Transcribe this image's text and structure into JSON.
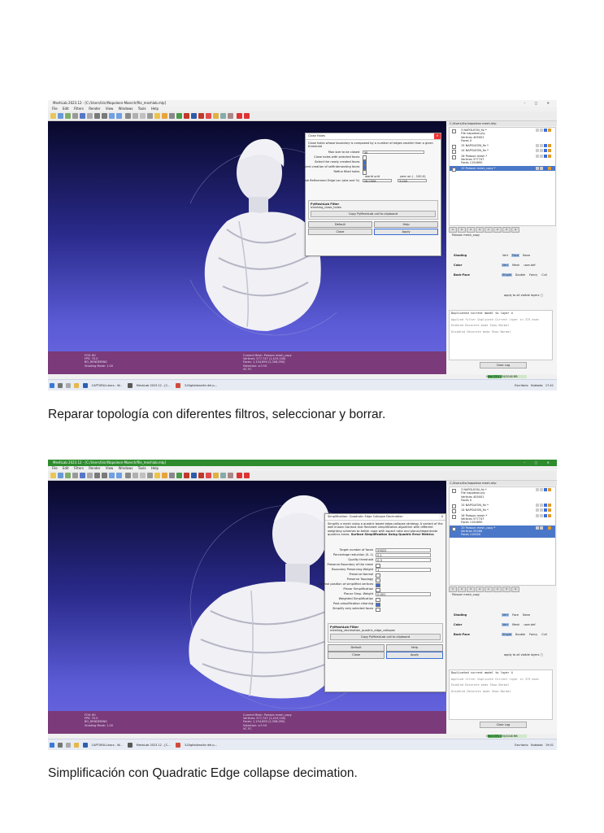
{
  "captions": {
    "first": "Reparar topología con diferentes filtros, seleccionar y borrar.",
    "second": "Simplificación con Quadratic Edge collapse decimation."
  },
  "app": {
    "title": "MeshLab 2023.12 - [C:/Users/Usr/Napoleon-Maerch/file_meshlab.mlp]",
    "menus": [
      "File",
      "Edit",
      "Filters",
      "Render",
      "View",
      "Windows",
      "Tools",
      "Help"
    ],
    "project_path": "C:/Users/Usr/napoleon mesh.mlp"
  },
  "layers": [
    {
      "id": "3",
      "name": "NAPOLEON_fix *",
      "file": "napoleon.ply",
      "vertices": "Vertices  405001",
      "faces": "Faces  0",
      "selected": false
    },
    {
      "id": "15",
      "name": "NAPOLEON_fix *",
      "selected": false
    },
    {
      "id": "14",
      "name": "NAPOLEON_fix *",
      "selected": false
    },
    {
      "id": "16",
      "name": "Poisson mesh *",
      "vertices": "Vertices  577747",
      "faces": "Faces  1154690",
      "selected": false
    },
    {
      "id": "10",
      "name": "Poisson mesh_copy *",
      "selected": true
    }
  ],
  "layer2_extra": {
    "vertices": "Vertices  55266",
    "faces": "Faces  110020"
  },
  "pager": [
    "1",
    "2",
    "3",
    "4",
    "1",
    "2",
    "3",
    "4"
  ],
  "panel": {
    "subtitle": "Poisson mesh_copy",
    "shading_label": "Shading",
    "shading_opts": [
      "Vert",
      "Face",
      "None"
    ],
    "color_label": "Color",
    "color_opts": [
      "Vert",
      "Mesh",
      "user-def"
    ],
    "backface_label": "Back-Face",
    "backface_opts": [
      "Single",
      "Double",
      "Fancy",
      "Cull"
    ],
    "apply_all": "apply to all visible layers"
  },
  "log": [
    "Duplicated current model to layer 4",
    "Applied filter Duplicate Current layer in 375 msec",
    "Enabled Decorate mode Show Normal",
    "Disabled Decorate mode Show Normal"
  ],
  "clear_log": "Clear Log",
  "status": {
    "mem": "Mem 25% 459/2048 MB"
  },
  "dialog1": {
    "title": "Close Holes",
    "description": "Close holes whose boundary is composed by a number of edges smaller than a given threshold",
    "params": [
      {
        "label": "Max size to be closed",
        "value": "30"
      },
      {
        "label": "Close holes with selected faces",
        "check": false
      },
      {
        "label": "Select the newly created faces",
        "check": true
      },
      {
        "label": "Prevent creation of selfIntersecting faces",
        "check": true
      },
      {
        "label": "Refine filled holes",
        "check": false
      }
    ],
    "edge_label": "Hole Refinement Edge Len (abs and %)",
    "world_unit": "world unit",
    "perc_label": "perc on ( - 100.0)",
    "edge_values": [
      "26.0306",
      "3.000"
    ],
    "pymeshlab_title": "PyMeshLab Filter",
    "pymeshlab_fn": "meshing_close_holes",
    "copy_btn": "Copy PyMeshLab call to clipboard",
    "default_btn": "Default",
    "help_btn": "Help",
    "close_btn": "Close",
    "apply_btn": "Apply"
  },
  "dialog2": {
    "title": "Simplification: Quadratic Edge Collapse Decimation",
    "description": "Simplify a mesh using a quadric based edge-collapse strategy. A variant of the well known Garland and Heckbert simplification algorithm with different weighting schemes to better cope with aspect ratio and planar/degenerate quadrics areas.",
    "description_bold": "Surface Simplification Using Quadric Error Metrics",
    "params": [
      {
        "label": "Target number of faces",
        "value": "55022"
      },
      {
        "label": "Percentage reduction (0..1)",
        "value": "0.1"
      },
      {
        "label": "Quality threshold",
        "value": "0.3"
      },
      {
        "label": "Preserve Boundary of the mesh",
        "check": false
      },
      {
        "label": "Boundary Preserving Weight",
        "value": "1"
      },
      {
        "label": "Preserve Normal",
        "check": false
      },
      {
        "label": "Preserve Topology",
        "check": false
      },
      {
        "label": "Optimal position of simplified vertices",
        "check": true
      },
      {
        "label": "Planar Simplification",
        "check": false
      },
      {
        "label": "Planar Simp. Weight",
        "value": "0.001"
      },
      {
        "label": "Weighted Simplification",
        "check": false
      },
      {
        "label": "Post-simplification cleaning",
        "check": true
      },
      {
        "label": "Simplify only selected faces",
        "check": false
      }
    ],
    "pymeshlab_title": "PyMeshLab Filter",
    "pymeshlab_fn": "meshing_decimation_quadric_edge_collapse",
    "copy_btn": "Copy PyMeshLab call to clipboard",
    "default_btn": "Default",
    "help_btn": "Help",
    "close_btn": "Close",
    "apply_btn": "Apply"
  },
  "viewport_info": {
    "left": [
      "FOV: 60",
      "FPS: 70.0",
      "BO_RENDERING",
      "Shading Mode: 1.00"
    ],
    "center": [
      "Current Mesh: Poisson mesh_copy",
      "Vertices: 577,747 (1,419,100)",
      "Faces: 1,154,690 (2,308,090)",
      "Selection: v:0 f:0",
      "VC FC"
    ]
  },
  "taskbar": {
    "apps": [
      "CAPTURA1.docx - W...",
      "MeshLab 2023.12 - [C...",
      "3-Digitalización del p..."
    ],
    "search": "Escritorio",
    "weather": "Nublado",
    "time1": "17:41",
    "time2": "19:01"
  }
}
